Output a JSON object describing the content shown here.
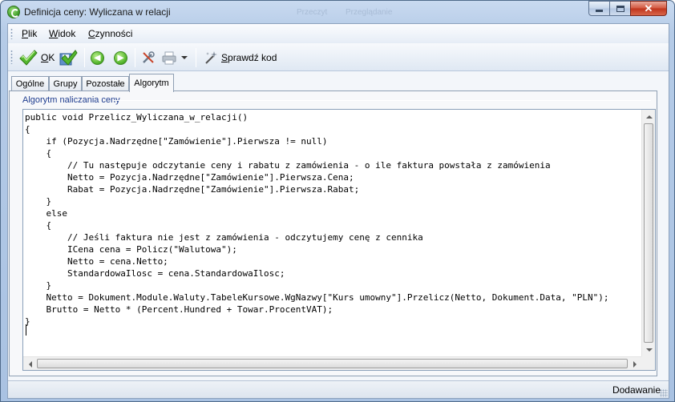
{
  "window": {
    "title": "Definicja ceny: Wyliczana w relacji",
    "ghost_title_left": "Przeczyt",
    "ghost_title_right": "Przeglądanie",
    "accent_color": "#b5cbe7"
  },
  "menu": {
    "items": [
      {
        "label": "Plik"
      },
      {
        "label": "Widok"
      },
      {
        "label": "Czynności"
      }
    ]
  },
  "toolbar": {
    "ok_label": "OK",
    "check_code_label": "Sprawdź kod",
    "icons": [
      "checkmark-icon",
      "save-checkmark-icon",
      "back-arrow-icon",
      "forward-arrow-icon",
      "tools-icon",
      "print-icon",
      "dropdown-arrow-icon",
      "wand-icon"
    ]
  },
  "tabs": [
    {
      "label": "Ogólne",
      "active": false
    },
    {
      "label": "Grupy",
      "active": false
    },
    {
      "label": "Pozostałe",
      "active": false
    },
    {
      "label": "Algorytm",
      "active": true
    }
  ],
  "algorithm_panel": {
    "group_title": "Algorytm naliczania ceny",
    "code_lines": [
      "public void Przelicz_Wyliczana_w_relacji()",
      "{",
      "    if (Pozycja.Nadrzędne[\"Zamówienie\"].Pierwsza != null)",
      "    {",
      "        // Tu następuje odczytanie ceny i rabatu z zamówienia - o ile faktura powstała z zamówienia",
      "        Netto = Pozycja.Nadrzędne[\"Zamówienie\"].Pierwsza.Cena;",
      "        Rabat = Pozycja.Nadrzędne[\"Zamówienie\"].Pierwsza.Rabat;",
      "    }",
      "    else",
      "    {",
      "        // Jeśli faktura nie jest z zamówienia - odczytujemy cenę z cennika",
      "        ICena cena = Policz(\"Walutowa\");",
      "        Netto = cena.Netto;",
      "        StandardowaIlosc = cena.StandardowaIlosc;",
      "    }",
      "    Netto = Dokument.Module.Waluty.TabeleKursowe.WgNazwy[\"Kurs umowny\"].Przelicz(Netto, Dokument.Data, \"PLN\");",
      "    Brutto = Netto * (Percent.Hundred + Towar.ProcentVAT);",
      "}"
    ]
  },
  "status": {
    "mode": "Dodawanie"
  }
}
